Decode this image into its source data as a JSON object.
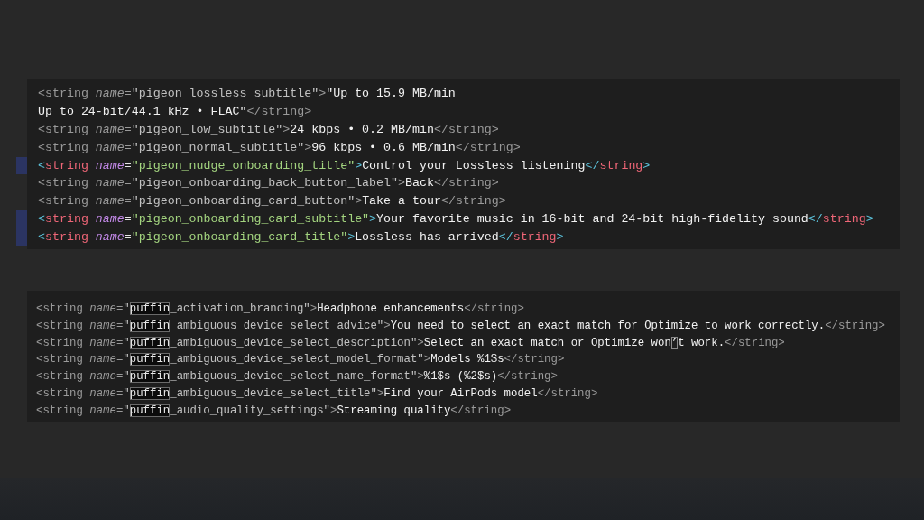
{
  "panels": [
    {
      "lines": [
        {
          "changed": false,
          "tokens": [
            {
              "kind": "bracket",
              "text": "<"
            },
            {
              "kind": "tag",
              "text": "string"
            },
            {
              "kind": "attr",
              "text": " name"
            },
            {
              "kind": "punct",
              "text": "="
            },
            {
              "kind": "key",
              "text": "\"pigeon_lossless_subtitle\""
            },
            {
              "kind": "bracket",
              "text": ">"
            },
            {
              "kind": "text",
              "text": "\"Up to 15.9 MB/min"
            }
          ]
        },
        {
          "changed": false,
          "tokens": [
            {
              "kind": "text",
              "text": "Up to 24-bit/44.1 kHz • FLAC\""
            },
            {
              "kind": "bracket",
              "text": "</"
            },
            {
              "kind": "tag",
              "text": "string"
            },
            {
              "kind": "bracket",
              "text": ">"
            }
          ]
        },
        {
          "changed": false,
          "tokens": [
            {
              "kind": "bracket",
              "text": "<"
            },
            {
              "kind": "tag",
              "text": "string"
            },
            {
              "kind": "attr",
              "text": " name"
            },
            {
              "kind": "punct",
              "text": "="
            },
            {
              "kind": "key",
              "text": "\"pigeon_low_subtitle\""
            },
            {
              "kind": "bracket",
              "text": ">"
            },
            {
              "kind": "text",
              "text": "24 kbps • 0.2 MB/min"
            },
            {
              "kind": "bracket",
              "text": "</"
            },
            {
              "kind": "tag",
              "text": "string"
            },
            {
              "kind": "bracket",
              "text": ">"
            }
          ]
        },
        {
          "changed": false,
          "tokens": [
            {
              "kind": "bracket",
              "text": "<"
            },
            {
              "kind": "tag",
              "text": "string"
            },
            {
              "kind": "attr",
              "text": " name"
            },
            {
              "kind": "punct",
              "text": "="
            },
            {
              "kind": "key",
              "text": "\"pigeon_normal_subtitle\""
            },
            {
              "kind": "bracket",
              "text": ">"
            },
            {
              "kind": "text",
              "text": "96 kbps • 0.6 MB/min"
            },
            {
              "kind": "bracket",
              "text": "</"
            },
            {
              "kind": "tag",
              "text": "string"
            },
            {
              "kind": "bracket",
              "text": ">"
            }
          ]
        },
        {
          "changed": true,
          "tokens": [
            {
              "kind": "bracket",
              "text": "<"
            },
            {
              "kind": "tag",
              "text": "string"
            },
            {
              "kind": "attr",
              "text": " name"
            },
            {
              "kind": "punct",
              "text": "="
            },
            {
              "kind": "key",
              "text": "\"pigeon_nudge_onboarding_title\""
            },
            {
              "kind": "bracket",
              "text": ">"
            },
            {
              "kind": "text",
              "text": "Control your Lossless listening"
            },
            {
              "kind": "bracket",
              "text": "</"
            },
            {
              "kind": "tag",
              "text": "string"
            },
            {
              "kind": "bracket",
              "text": ">"
            }
          ]
        },
        {
          "changed": false,
          "tokens": [
            {
              "kind": "bracket",
              "text": "<"
            },
            {
              "kind": "tag",
              "text": "string"
            },
            {
              "kind": "attr",
              "text": " name"
            },
            {
              "kind": "punct",
              "text": "="
            },
            {
              "kind": "key",
              "text": "\"pigeon_onboarding_back_button_label\""
            },
            {
              "kind": "bracket",
              "text": ">"
            },
            {
              "kind": "text",
              "text": "Back"
            },
            {
              "kind": "bracket",
              "text": "</"
            },
            {
              "kind": "tag",
              "text": "string"
            },
            {
              "kind": "bracket",
              "text": ">"
            }
          ]
        },
        {
          "changed": false,
          "tokens": [
            {
              "kind": "bracket",
              "text": "<"
            },
            {
              "kind": "tag",
              "text": "string"
            },
            {
              "kind": "attr",
              "text": " name"
            },
            {
              "kind": "punct",
              "text": "="
            },
            {
              "kind": "key",
              "text": "\"pigeon_onboarding_card_button\""
            },
            {
              "kind": "bracket",
              "text": ">"
            },
            {
              "kind": "text",
              "text": "Take a tour"
            },
            {
              "kind": "bracket",
              "text": "</"
            },
            {
              "kind": "tag",
              "text": "string"
            },
            {
              "kind": "bracket",
              "text": ">"
            }
          ]
        },
        {
          "changed": true,
          "tokens": [
            {
              "kind": "bracket",
              "text": "<"
            },
            {
              "kind": "tag",
              "text": "string"
            },
            {
              "kind": "attr",
              "text": " name"
            },
            {
              "kind": "punct",
              "text": "="
            },
            {
              "kind": "key",
              "text": "\"pigeon_onboarding_card_subtitle\""
            },
            {
              "kind": "bracket",
              "text": ">"
            },
            {
              "kind": "text",
              "text": "Your favorite music in 16-bit and 24-bit high-fidelity sound"
            },
            {
              "kind": "bracket",
              "text": "</"
            },
            {
              "kind": "tag",
              "text": "string"
            },
            {
              "kind": "bracket",
              "text": ">"
            }
          ]
        },
        {
          "changed": true,
          "tokens": [
            {
              "kind": "bracket",
              "text": "<"
            },
            {
              "kind": "tag",
              "text": "string"
            },
            {
              "kind": "attr",
              "text": " name"
            },
            {
              "kind": "punct",
              "text": "="
            },
            {
              "kind": "key",
              "text": "\"pigeon_onboarding_card_title\""
            },
            {
              "kind": "bracket",
              "text": ">"
            },
            {
              "kind": "text",
              "text": "Lossless has arrived"
            },
            {
              "kind": "bracket",
              "text": "</"
            },
            {
              "kind": "tag",
              "text": "string"
            },
            {
              "kind": "bracket",
              "text": ">"
            }
          ]
        }
      ]
    },
    {
      "lines": [
        {
          "changed": false,
          "tokens": [
            {
              "kind": "bracket",
              "text": "<"
            },
            {
              "kind": "tag",
              "text": "string"
            },
            {
              "kind": "attr",
              "text": " name"
            },
            {
              "kind": "punct",
              "text": "="
            },
            {
              "kind": "key",
              "text": "\""
            },
            {
              "kind": "match",
              "text": "puffin"
            },
            {
              "kind": "key",
              "text": "_activation_branding\""
            },
            {
              "kind": "bracket",
              "text": ">"
            },
            {
              "kind": "text",
              "text": "Headphone enhancements"
            },
            {
              "kind": "bracket",
              "text": "</"
            },
            {
              "kind": "tag",
              "text": "string"
            },
            {
              "kind": "bracket",
              "text": ">"
            }
          ]
        },
        {
          "changed": false,
          "tokens": [
            {
              "kind": "bracket",
              "text": "<"
            },
            {
              "kind": "tag",
              "text": "string"
            },
            {
              "kind": "attr",
              "text": " name"
            },
            {
              "kind": "punct",
              "text": "="
            },
            {
              "kind": "key",
              "text": "\""
            },
            {
              "kind": "match",
              "text": "puffin"
            },
            {
              "kind": "key",
              "text": "_ambiguous_device_select_advice\""
            },
            {
              "kind": "bracket",
              "text": ">"
            },
            {
              "kind": "text",
              "text": "You need to select an exact match for Optimize to work correctly."
            },
            {
              "kind": "bracket",
              "text": "</"
            },
            {
              "kind": "tag",
              "text": "string"
            },
            {
              "kind": "bracket",
              "text": ">"
            }
          ]
        },
        {
          "changed": false,
          "tokens": [
            {
              "kind": "bracket",
              "text": "<"
            },
            {
              "kind": "tag",
              "text": "string"
            },
            {
              "kind": "attr",
              "text": " name"
            },
            {
              "kind": "punct",
              "text": "="
            },
            {
              "kind": "key",
              "text": "\""
            },
            {
              "kind": "match",
              "text": "puffin"
            },
            {
              "kind": "key",
              "text": "_ambiguous_device_select_description\""
            },
            {
              "kind": "bracket",
              "text": ">"
            },
            {
              "kind": "text",
              "text": "Select an exact match or Optimize won"
            },
            {
              "kind": "flagged",
              "text": "’"
            },
            {
              "kind": "text",
              "text": "t work."
            },
            {
              "kind": "bracket",
              "text": "</"
            },
            {
              "kind": "tag",
              "text": "string"
            },
            {
              "kind": "bracket",
              "text": ">"
            }
          ]
        },
        {
          "changed": false,
          "tokens": [
            {
              "kind": "bracket",
              "text": "<"
            },
            {
              "kind": "tag",
              "text": "string"
            },
            {
              "kind": "attr",
              "text": " name"
            },
            {
              "kind": "punct",
              "text": "="
            },
            {
              "kind": "key",
              "text": "\""
            },
            {
              "kind": "match",
              "text": "puffin"
            },
            {
              "kind": "key",
              "text": "_ambiguous_device_select_model_format\""
            },
            {
              "kind": "bracket",
              "text": ">"
            },
            {
              "kind": "text",
              "text": "Models %1$s"
            },
            {
              "kind": "bracket",
              "text": "</"
            },
            {
              "kind": "tag",
              "text": "string"
            },
            {
              "kind": "bracket",
              "text": ">"
            }
          ]
        },
        {
          "changed": false,
          "tokens": [
            {
              "kind": "bracket",
              "text": "<"
            },
            {
              "kind": "tag",
              "text": "string"
            },
            {
              "kind": "attr",
              "text": " name"
            },
            {
              "kind": "punct",
              "text": "="
            },
            {
              "kind": "key",
              "text": "\""
            },
            {
              "kind": "match",
              "text": "puffin"
            },
            {
              "kind": "key",
              "text": "_ambiguous_device_select_name_format\""
            },
            {
              "kind": "bracket",
              "text": ">"
            },
            {
              "kind": "text",
              "text": "%1$s (%2$s)"
            },
            {
              "kind": "bracket",
              "text": "</"
            },
            {
              "kind": "tag",
              "text": "string"
            },
            {
              "kind": "bracket",
              "text": ">"
            }
          ]
        },
        {
          "changed": false,
          "tokens": [
            {
              "kind": "bracket",
              "text": "<"
            },
            {
              "kind": "tag",
              "text": "string"
            },
            {
              "kind": "attr",
              "text": " name"
            },
            {
              "kind": "punct",
              "text": "="
            },
            {
              "kind": "key",
              "text": "\""
            },
            {
              "kind": "match",
              "text": "puffin"
            },
            {
              "kind": "key",
              "text": "_ambiguous_device_select_title\""
            },
            {
              "kind": "bracket",
              "text": ">"
            },
            {
              "kind": "text",
              "text": "Find your AirPods model"
            },
            {
              "kind": "bracket",
              "text": "</"
            },
            {
              "kind": "tag",
              "text": "string"
            },
            {
              "kind": "bracket",
              "text": ">"
            }
          ]
        },
        {
          "changed": false,
          "tokens": [
            {
              "kind": "bracket",
              "text": "<"
            },
            {
              "kind": "tag",
              "text": "string"
            },
            {
              "kind": "attr",
              "text": " name"
            },
            {
              "kind": "punct",
              "text": "="
            },
            {
              "kind": "key",
              "text": "\""
            },
            {
              "kind": "match",
              "text": "puffin"
            },
            {
              "kind": "key",
              "text": "_audio_quality_settings\""
            },
            {
              "kind": "bracket",
              "text": ">"
            },
            {
              "kind": "text",
              "text": "Streaming quality"
            },
            {
              "kind": "bracket",
              "text": "</"
            },
            {
              "kind": "tag",
              "text": "string"
            },
            {
              "kind": "bracket",
              "text": ">"
            }
          ]
        }
      ]
    }
  ]
}
